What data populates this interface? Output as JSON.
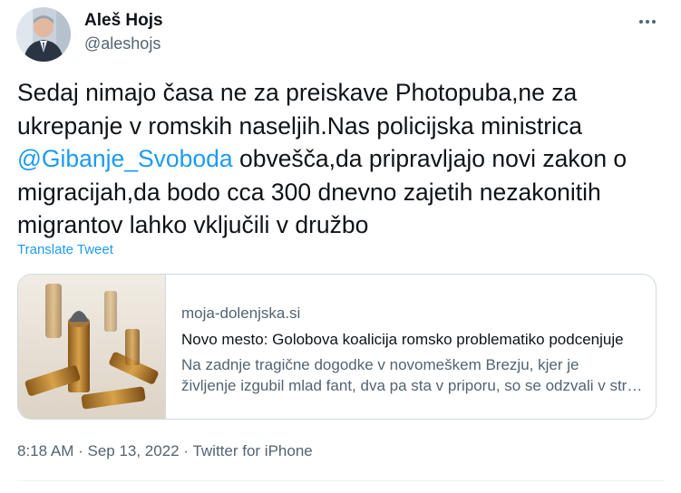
{
  "author": {
    "name": "Aleš Hojs",
    "handle": "@aleshojs"
  },
  "tweet": {
    "text_before": "Sedaj nimajo časa ne za preiskave Photopuba,ne za ukrepanje v romskih naseljih.Nas policijska ministrica ",
    "mention": "@Gibanje_Svoboda",
    "text_after": " obvešča,da pripravljajo novi zakon o migracijah,da bodo cca 300 dnevno zajetih nezakonitih migrantov lahko vključili v družbo",
    "translate_label": "Translate Tweet"
  },
  "card": {
    "domain": "moja-dolenjska.si",
    "title": "Novo mesto: Golobova koalicija romsko problematiko podcenjuje",
    "desc_line1": "Na zadnje tragične dogodke v novomeškem Brezju, kjer je",
    "desc_line2": "življenje izgubil mlad fant, dva pa sta v priporu, so se odzvali v stranki"
  },
  "meta": {
    "time": "8:18 AM",
    "sep1": " · ",
    "date": "Sep 13, 2022",
    "sep2": " · ",
    "source": "Twitter for iPhone"
  },
  "icons": {
    "more": "more-options-icon",
    "avatar": "profile-avatar",
    "card_image": "bullets-photo"
  },
  "colors": {
    "link": "#1d9bf0",
    "secondary_text": "#536471",
    "border": "#cfd9de"
  }
}
